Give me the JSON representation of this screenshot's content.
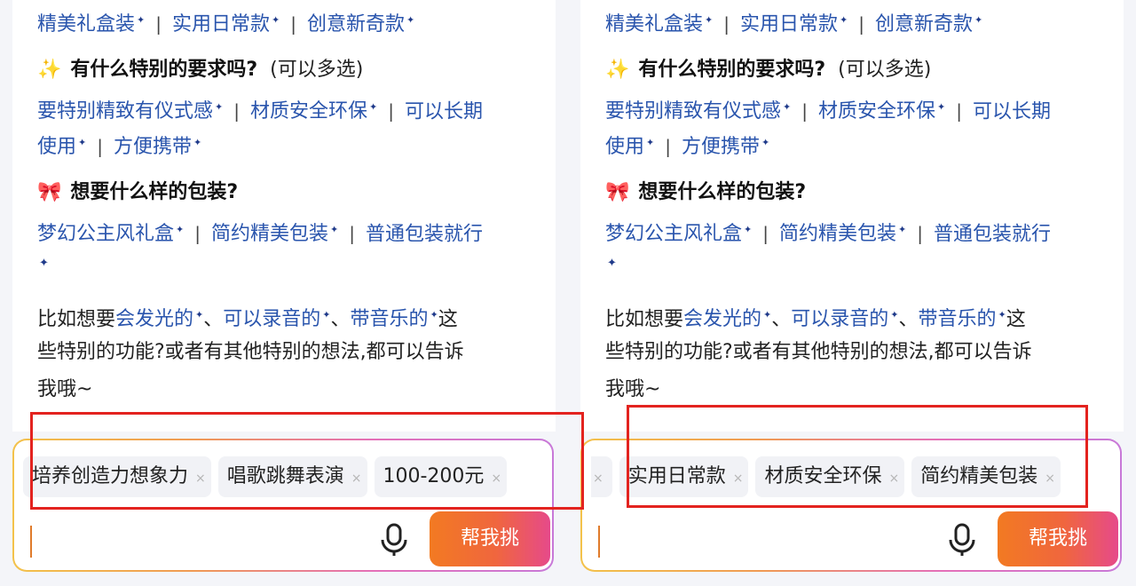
{
  "option_rows": {
    "row1": [
      "精美礼盒装",
      "实用日常款",
      "创意新奇款"
    ],
    "requirements": {
      "emoji": "✨",
      "title": "有什么特别的要求吗?",
      "note": "(可以多选)",
      "line1": [
        "要特别精致有仪式感",
        "材质安全环保",
        "可以长期"
      ],
      "line2": [
        "使用",
        "方便携带"
      ]
    },
    "packaging": {
      "emoji": "🎀",
      "title": "想要什么样的包装?",
      "line1": [
        "梦幻公主风礼盒",
        "简约精美包装",
        "普通包装就行"
      ],
      "line2_spark": "✦"
    }
  },
  "features": {
    "prefix": "比如想要",
    "items": [
      "会发光的",
      "可以录音的",
      "带音乐的"
    ],
    "comma": "、",
    "suffix1": "这",
    "line2": "些特别的功能?或者有其他特别的想法,都可以告诉",
    "line3": "我哦~"
  },
  "sparkle": "✦",
  "separator": "|",
  "left_composer": {
    "chips": [
      "培养创造力想象力",
      "唱歌跳舞表演",
      "100-200元"
    ],
    "button": "帮我挑"
  },
  "right_composer": {
    "chips": [
      "",
      "实用日常款",
      "材质安全环保",
      "简约精美包装"
    ],
    "button": "帮我挑"
  },
  "chip_close": "×",
  "colors": {
    "link": "#2a55ad",
    "highlight_box": "#e3231f",
    "button_gradient": [
      "#f27a22",
      "#e64a8a"
    ]
  }
}
